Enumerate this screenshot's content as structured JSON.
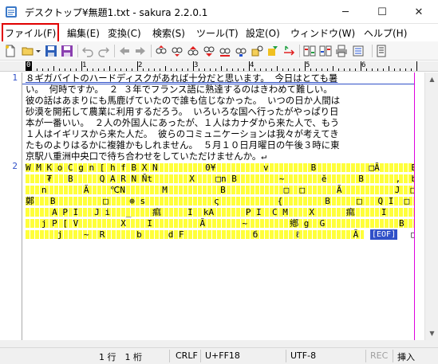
{
  "window": {
    "title": "デスクトップ¥無題1.txt - sakura 2.2.0.1",
    "minimize_glyph": "─",
    "maximize_glyph": "☐",
    "close_glyph": "✕"
  },
  "menu": {
    "items": [
      {
        "label": "ファイル(F)",
        "highlighted": true
      },
      {
        "label": "編集(E)"
      },
      {
        "label": "変換(C)"
      },
      {
        "label": "検索(S)"
      },
      {
        "label": "ツール(T)"
      },
      {
        "label": "設定(O)"
      },
      {
        "label": "ウィンドウ(W)"
      },
      {
        "label": "ヘルプ(H)"
      }
    ]
  },
  "toolbar": {
    "icons": [
      "new-file-icon",
      "open-file-icon",
      "dropdown-icon",
      "save-icon",
      "save-as-icon",
      "undo-icon",
      "redo-icon",
      "jump-back-icon",
      "jump-forward-icon",
      "search-previous-icon",
      "search-next-icon",
      "search-icon",
      "replace-icon",
      "find-box-icon",
      "grep-icon",
      "tag-jump-icon",
      "outline-icon",
      "print-icon",
      "properties-icon",
      "settings-icon",
      "help-icon"
    ]
  },
  "ruler": {
    "labels": [
      "0",
      "1",
      "2",
      "3",
      "4",
      "5",
      "6"
    ]
  },
  "editor": {
    "line_numbers": [
      "1",
      "2"
    ],
    "text_lines": [
      "８ギガバイトのハードディスクがあれば十分だと思います。 今日はとても暑",
      "い。 何時ですか。 ２ ３年でフランス語に熟達するのはきわめて難しい。",
      "彼の話はあまりにも馬鹿げていたので誰も信じなかった。 いつの日か人間は",
      "砂漠を開拓して農業に利用するだろう。 いろいろな国へ行ったがやっぱり日",
      "本が一番いい。 ２人の外国人にあったが、１人はカナダから来た人で、もう",
      "１人はイギリスから来た人だ。 彼らのコミュニケーションは我々が考えてき",
      "たものよりはるかに複雑かもしれません。 ５月１０日月曜日の午後３時に東",
      "京駅八重洲中央口で待ち合わせをしていただけませんか。↵"
    ],
    "binary_lines": [
      "W M K o C g n [ h f B X N         0¥         v        B          □Ă      B",
      "    ₮   B     Q A R N Ňt       X    □n B        ~       ĕ      B      ,  b   □",
      "   n       Ă    ℃N       M          B           □  □      Ă          J  □Ĕ  □d  p",
      "鄭   B         □    ⊕ s             ς           {        B     □   Q I  □   I  □",
      "     A P I   J i   _    痲     I  kA      P I  C M    X      痲     I       B       R",
      "   j P [ V        X    I         Ă       ~        鄕 g  G              B  T   P O",
      "      j    ~  R      b     d F             б       ℓ          Ă          □B"
    ],
    "eof_label": "[EOF]"
  },
  "status": {
    "position": "1 行　1 桁",
    "line_ending": "CRLF",
    "char_code": "U+FF18",
    "encoding": "UTF-8",
    "rec": "REC",
    "insert_mode": "挿入"
  }
}
